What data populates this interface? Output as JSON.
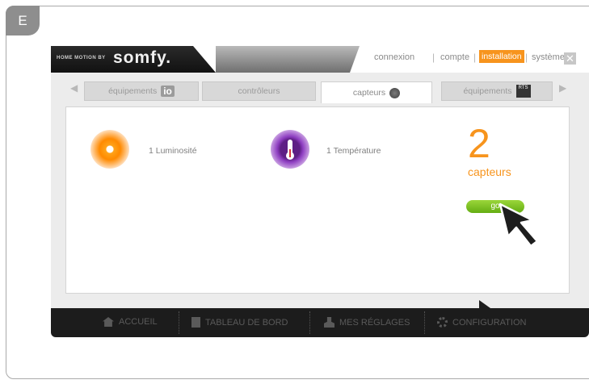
{
  "step_label": "E",
  "brand": {
    "tagline": "HOME MOTION BY",
    "logo": "somfy."
  },
  "topnav": {
    "items": [
      {
        "label": "connexion"
      },
      {
        "label": "compte"
      },
      {
        "label": "installation"
      },
      {
        "label": "système io"
      }
    ],
    "active": "installation",
    "close_glyph": "✕"
  },
  "tabs": {
    "prev_arrow": "◀",
    "next_arrow": "▶",
    "items": [
      {
        "label": "équipements",
        "badge": "io"
      },
      {
        "label": "contrôleurs",
        "badge": ""
      },
      {
        "label": "capteurs",
        "badge": ""
      },
      {
        "label": "équipements",
        "badge": "RTS"
      }
    ],
    "active_index": 2
  },
  "sensors": [
    {
      "label": "1 Luminosité",
      "icon": "sun-icon"
    },
    {
      "label": "1 Température",
      "icon": "thermometer-icon"
    }
  ],
  "summary": {
    "count": "2",
    "label": "capteurs",
    "go_button": "go"
  },
  "bottom_nav": [
    {
      "label": "ACCUEIL",
      "icon": "home-icon"
    },
    {
      "label": "TABLEAU DE BORD",
      "icon": "dashboard-icon"
    },
    {
      "label": "MES RÉGLAGES",
      "icon": "user-icon"
    },
    {
      "label": "CONFIGURATION",
      "icon": "gear-icon"
    }
  ],
  "colors": {
    "accent": "#f7941d",
    "go": "#7ec321",
    "dark": "#1c1c1c"
  }
}
